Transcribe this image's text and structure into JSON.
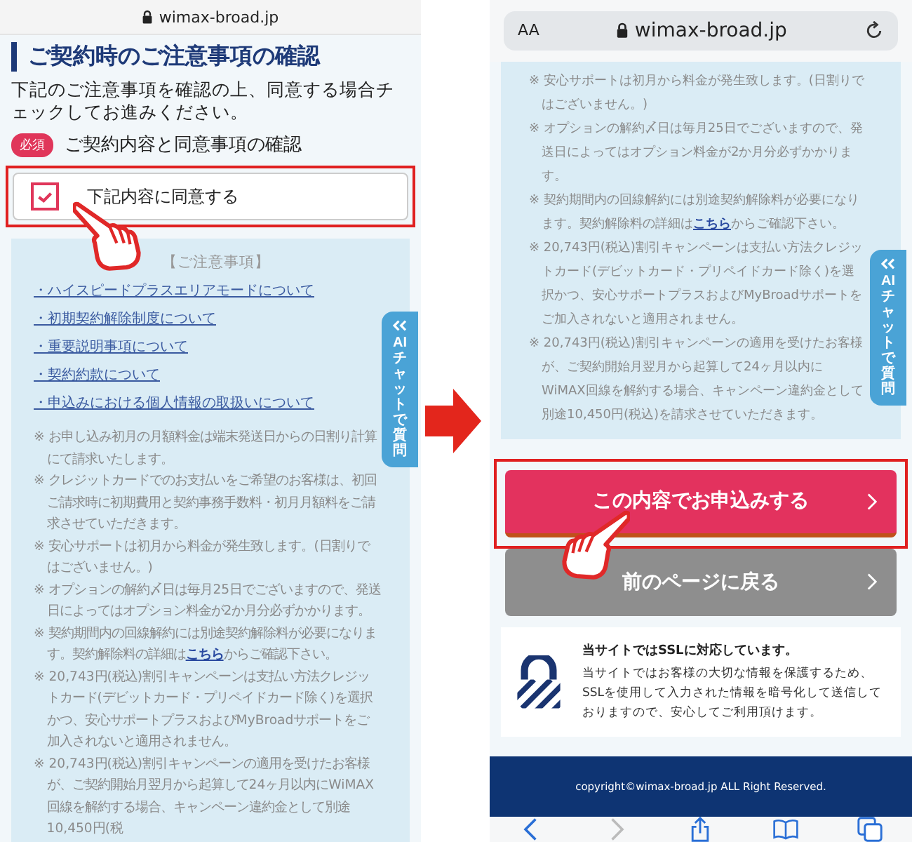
{
  "left_screen": {
    "address_bar": {
      "url": "wimax-broad.jp"
    },
    "heading": "ご契約時のご注意事項の確認",
    "description": "下記のご注意事項を確認の上、同意する場合チェックしてお進みください。",
    "required_badge": "必須",
    "field_label": "ご契約内容と同意事項の確認",
    "agree_checkbox": {
      "label": "下記内容に同意する",
      "checked": true,
      "highlighted": true
    },
    "notice": {
      "title": "【ご注意事項】",
      "links": [
        "・ハイスピードプラスエリアモードについて",
        "・初期契約解除制度について",
        "・重要説明事項について",
        "・契約約款について",
        "・申込みにおける個人情報の取扱いについて"
      ],
      "notes": [
        {
          "text": "※ お申し込み初月の月額料金は端末発送日からの日割り計算にて請求いたします。"
        },
        {
          "text": "※ クレジットカードでのお支払いをご希望のお客様は、初回ご請求時に初期費用と契約事務手数料・初月月額料をご請求させていただきます。"
        },
        {
          "text": "※ 安心サポートは初月から料金が発生致します。(日割りではございません。)"
        },
        {
          "text": "※ オプションの解約〆日は毎月25日でございますので、発送日によってはオプション料金が2か月分必ずかかります。"
        },
        {
          "text": "※ 契約期間内の回線解約には別途契約解除料が必要になります。契約解除料の詳細は",
          "link": "こちら",
          "after": "からご確認下さい。"
        },
        {
          "text": "※ 20,743円(税込)割引キャンペーンは支払い方法クレジットカード(デビットカード・プリペイドカード除く)を選択かつ、安心サポートプラスおよびMyBroadサポートをご加入されないと適用されません。"
        },
        {
          "text": "※ 20,743円(税込)割引キャンペーンの適用を受けたお客様が、ご契約開始月翌月から起算して24ヶ月以内にWiMAX回線を解約する場合、キャンペーン違約金として別途10,450円(税"
        }
      ]
    },
    "chat_tab": {
      "label": "AIチャットで質問"
    }
  },
  "right_screen": {
    "address_bar": {
      "text_size": "AA",
      "url": "wimax-broad.jp"
    },
    "notes": [
      {
        "text": "※ 安心サポートは初月から料金が発生致します。(日割りではございません。)"
      },
      {
        "text": "※ オプションの解約〆日は毎月25日でございますので、発送日によってはオプション料金が2か月分必ずかかります。"
      },
      {
        "text": "※ 契約期間内の回線解約には別途契約解除料が必要になります。契約解除料の詳細は",
        "link": "こちら",
        "after": "からご確認下さい。"
      },
      {
        "text": "※ 20,743円(税込)割引キャンペーンは支払い方法クレジットカード(デビットカード・プリペイドカード除く)を選択かつ、安心サポートプラスおよびMyBroadサポートをご加入されないと適用されません。"
      },
      {
        "text": "※ 20,743円(税込)割引キャンペーンの適用を受けたお客様が、ご契約開始月翌月から起算して24ヶ月以内にWiMAX回線を解約する場合、キャンペーン違約金として別途10,450円(税込)を請求させていただきます。"
      }
    ],
    "chat_tab": {
      "label": "AIチャットで質問"
    },
    "buttons": [
      {
        "label": "この内容でお申込みする",
        "kind": "primary",
        "highlighted": true
      },
      {
        "label": "前のページに戻る",
        "kind": "secondary",
        "highlighted": false
      }
    ],
    "ssl_notice": {
      "title": "当サイトではSSLに対応しています。",
      "body": "当サイトではお客様の大切な情報を保護するため、SSLを使用して入力された情報を暗号化して送信しておりますので、安心してご利用頂けます。"
    },
    "footer": "copyright©wimax-broad.jp ALL Right Reserved."
  }
}
